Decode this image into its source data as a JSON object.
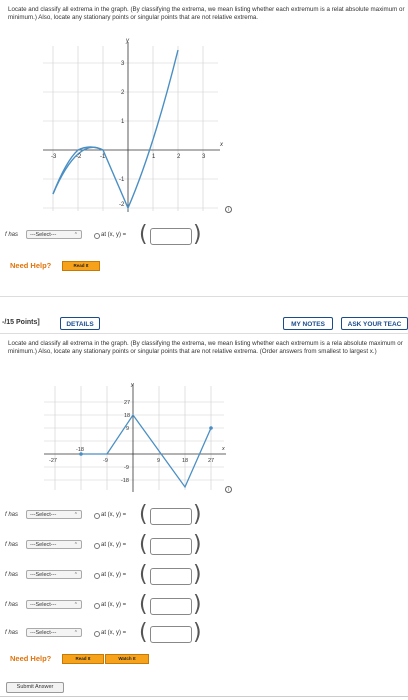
{
  "q1": {
    "instructions": "Locate and classify all extrema in the graph. (By classifying the extrema, we mean listing whether each extremum is a relat absolute maximum or minimum.) Also, locate any stationary points or singular points that are not relative extrema.",
    "graph": {
      "x_ticks": [
        "-3",
        "-2",
        "-1",
        "1",
        "2",
        "3"
      ],
      "y_ticks": [
        "3",
        "2",
        "1",
        "-1",
        "-2"
      ],
      "x_label": "x",
      "y_label": "y"
    },
    "rows": [
      {
        "prefix": "f has",
        "select": "---Select---",
        "at": "at (x, y) ="
      }
    ],
    "need_help": "Need Help?",
    "read_it": "Read It"
  },
  "q2": {
    "points": "-/15 Points]",
    "details": "DETAILS",
    "my_notes": "MY NOTES",
    "ask_teacher": "ASK YOUR TEAC",
    "instructions": "Locate and classify all extrema in the graph. (By classifying the extrema, we mean listing whether each extremum is a rela absolute maximum or minimum.) Also, locate any stationary points or singular points that are not relative extrema. (Order answers from smallest to largest x.)",
    "graph": {
      "x_ticks": [
        "-27",
        "-18",
        "-9",
        "9",
        "18",
        "27"
      ],
      "y_ticks": [
        "27",
        "18",
        "9",
        "-9",
        "-18"
      ],
      "x_label": "x",
      "y_label": "y"
    },
    "rows": [
      {
        "prefix": "f has",
        "select": "---Select---",
        "at": "at (x, y) ="
      },
      {
        "prefix": "f has",
        "select": "---Select---",
        "at": "at (x, y) ="
      },
      {
        "prefix": "f has",
        "select": "---Select---",
        "at": "at (x, y) ="
      },
      {
        "prefix": "f has",
        "select": "---Select---",
        "at": "at (x, y) ="
      },
      {
        "prefix": "f has",
        "select": "---Select---",
        "at": "at (x, y) ="
      }
    ],
    "need_help": "Need Help?",
    "read_it": "Read It",
    "watch_it": "Watch It",
    "submit": "Submit Answer"
  },
  "colors": {
    "curve": "#4a8fc4",
    "grid": "#cfcfcf",
    "accent": "#f7a21b",
    "header_blue": "#1a4c8c"
  }
}
